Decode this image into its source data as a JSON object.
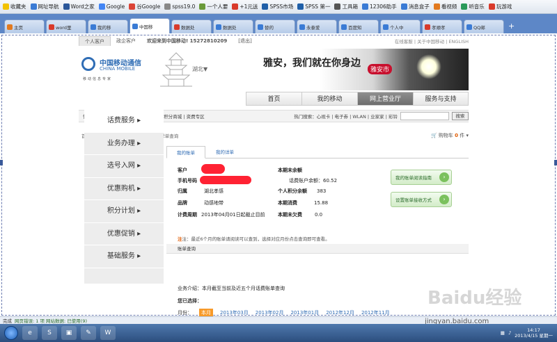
{
  "favorites": [
    "收藏夹",
    "网址导航",
    "Word之家",
    "Google",
    "谷Google",
    "spss19.0",
    "一个人要",
    "+1元送",
    "SPSS市场",
    "SPSS 第一",
    "工具箱",
    "12306助手",
    "消息盒子",
    "看视频",
    "听音乐",
    "玩游戏"
  ],
  "tabs": [
    "主页",
    "word里",
    "我的移",
    "中国移",
    "数据处",
    "数据处",
    "替的",
    "永泰爱",
    "百度知",
    "个人中",
    "孝顺孝",
    "QQ邮"
  ],
  "topnav": {
    "personal": "个人客户",
    "group": "政企客户",
    "welcome": "欢迎来到中国移动! 15272810209",
    "logout": "[退出]",
    "right": "在线客服 | 关于中国移动 | ENGLISH"
  },
  "logo": {
    "cn": "中国移动通信",
    "en": "CHINA MOBILE",
    "sub": "移动信息专家",
    "region": "湖北▼"
  },
  "banner": {
    "slogan": "雅安，我们就在你身边",
    "city": "雅安市"
  },
  "mainnav": [
    "首页",
    "我的移动",
    "网上营业厅",
    "服务与支持"
  ],
  "subnav": {
    "left": "快速办理通道 | 选号 | 购机 | 网上文惠 | 积分商城 | 资费专区",
    "hot": "热门搜索：心视卡 | 电子券 | WLAN | 业家家 | 彩铃",
    "search_btn": "搜索"
  },
  "breadcrumb": "首页 > 网上营业厅 > 话费服务 > 账单详单查询",
  "cart": {
    "label": "购物车",
    "count": "0",
    "unit": "件 ▾"
  },
  "sidebar": [
    "话费服务 ▸",
    "业务办理 ▸",
    "选号入网 ▸",
    "优惠购机 ▸",
    "积分计划 ▸",
    "优惠促销 ▸",
    "基础服务 ▸"
  ],
  "content_tabs": [
    "我的账单",
    "我的详单"
  ],
  "info": {
    "customer_lbl": "客户",
    "phone_lbl": "手机号码",
    "region_lbl": "归属",
    "region_val": "湖北孝感",
    "brand_lbl": "品牌",
    "brand_val": "动感地带",
    "cycle_lbl": "计费周期",
    "cycle_val": "2013年04月01日起截止目前",
    "balance_lbl": "本期末余额",
    "acct_lbl": "话费账户余额：",
    "acct_val": "60.52",
    "points_lbl": "个人积分余额",
    "points_val": "383",
    "spend_lbl": "本期消费",
    "spend_val": "15.88",
    "unpaid_lbl": "本期末欠费",
    "unpaid_val": "0.0"
  },
  "buttons": [
    "我的账单阅读指南",
    "设置账单接收方式"
  ],
  "note": "注：最近6个月的账单请阅读可以查到，选择对应月份点击查询即可查看。",
  "section_title": "账单查询",
  "biz_intro": "业务介绍：本月截至当前及近五个月话费账单查询",
  "pick_label": "您已选择：",
  "months_label": "月份：",
  "months": [
    "本月",
    "2013年03月",
    "2013年02月",
    "2013年01月",
    "2012年12月",
    "2012年11月"
  ],
  "watermark": "Baidu经验",
  "watermark_url": "jingyan.baidu.com",
  "status": {
    "done": "完成",
    "detail": "网页错误: 1 项 网站数据: 已使用(9)"
  },
  "clock": {
    "time": "14:17",
    "date": "2013/4/15 星期一"
  }
}
